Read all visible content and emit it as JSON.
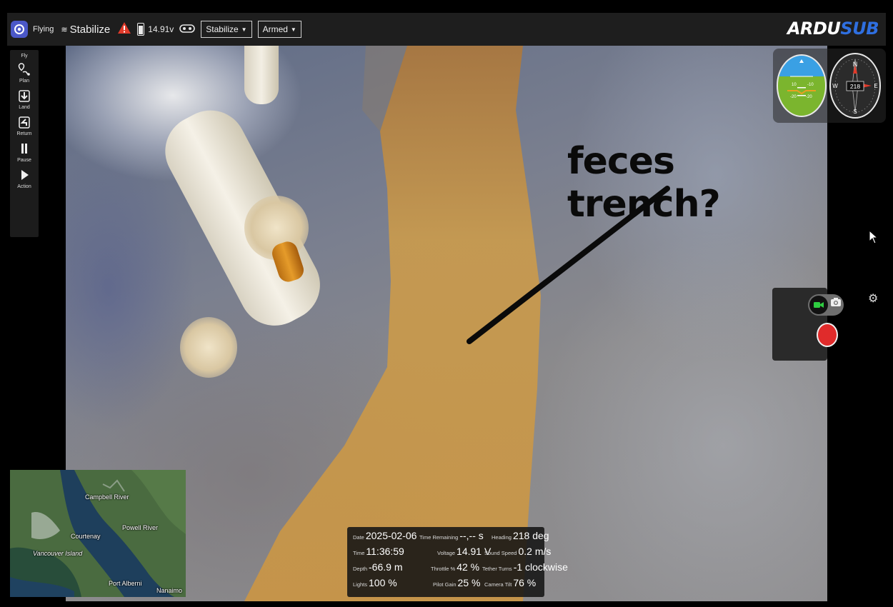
{
  "topbar": {
    "flight_status": "Flying",
    "mode_indicator": "Stabilize",
    "battery_voltage": "14.91v",
    "mode_dropdown": "Stabilize",
    "arm_dropdown": "Armed",
    "brand_left": "ARDU",
    "brand_right": "SUB"
  },
  "toolbar": {
    "header": "Fly",
    "items": [
      {
        "label": "Plan",
        "icon": "plan-icon"
      },
      {
        "label": "Land",
        "icon": "land-icon"
      },
      {
        "label": "Return",
        "icon": "return-icon"
      },
      {
        "label": "Pause",
        "icon": "pause-icon"
      },
      {
        "label": "Action",
        "icon": "action-icon"
      }
    ]
  },
  "instruments": {
    "attitude_scale": [
      "10",
      "-10",
      "-20",
      "-20"
    ],
    "compass_heading": "218",
    "compass_n": "N",
    "compass_s": "S",
    "compass_e": "E",
    "compass_w": "W"
  },
  "annotation": {
    "text": "feces trench?"
  },
  "map": {
    "labels": [
      "Campbell River",
      "Courtenay",
      "Powell River",
      "Vancouver Island",
      "Port Alberni",
      "Nanaimo"
    ]
  },
  "telemetry": {
    "date_label": "Date",
    "date": "2025-02-06",
    "time_remaining_label": "Time Remaining",
    "time_remaining": "--,-- s",
    "heading_label": "Heading",
    "heading": "218 deg",
    "time_label": "Time",
    "time": "11:36:59",
    "voltage_label": "Voltage",
    "voltage": "14.91 V",
    "sound_speed_label": "Sound Speed",
    "sound_speed": "0.2 m/s",
    "depth_label": "Depth",
    "depth": "-66.9 m",
    "throttle_label": "Throttle %",
    "throttle": "42 %",
    "tether_label": "Tether Turns",
    "tether": "-1 clockwise",
    "lights_label": "Lights",
    "lights": "100 %",
    "pilot_gain_label": "Pilot Gain",
    "pilot_gain": "25 %",
    "camera_tilt_label": "Camera Tilt",
    "camera_tilt": "76 %"
  },
  "colors": {
    "accent": "#4b58c8",
    "record": "#e02b2b",
    "warning": "#e03a2a",
    "trench": "#c99a4a"
  }
}
